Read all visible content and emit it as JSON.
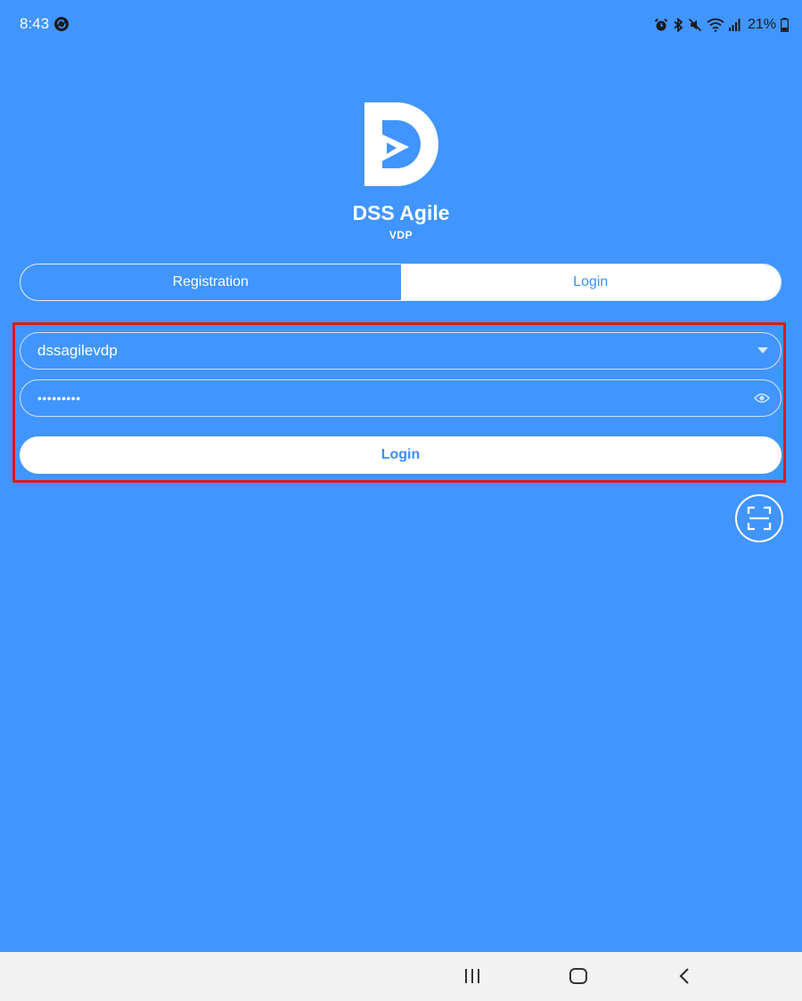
{
  "status_bar": {
    "time": "8:43",
    "battery": "21%",
    "icons": [
      "sync-icon",
      "alarm-icon",
      "bluetooth-icon",
      "mute-icon",
      "wifi-icon",
      "signal-icon",
      "battery-icon"
    ]
  },
  "app": {
    "name": "DSS Agile",
    "subtitle": "VDP"
  },
  "tabs": {
    "registration": "Registration",
    "login": "Login",
    "active": "login"
  },
  "form": {
    "username": "dssagilevdp",
    "password_masked": "•••••••••",
    "login_button": "Login"
  },
  "colors": {
    "background": "#4195FF",
    "accent_text": "#3E8FF2",
    "highlight_border": "#E01818",
    "nav_bar": "#F2F2F2"
  },
  "nav_bar": {
    "icons": [
      "recent-apps-icon",
      "home-icon",
      "back-icon"
    ]
  }
}
